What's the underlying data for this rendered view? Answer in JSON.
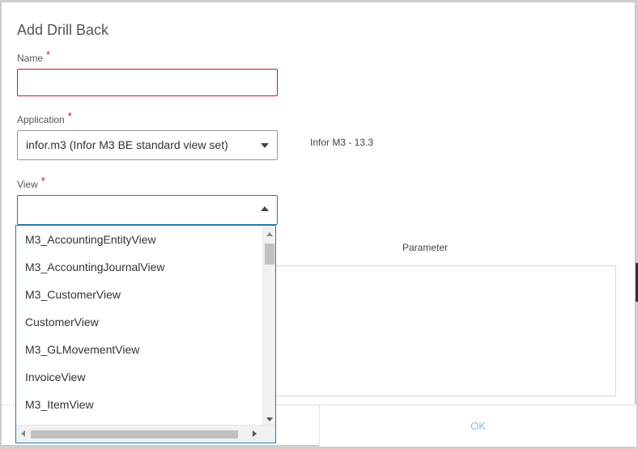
{
  "dialog": {
    "title": "Add Drill Back",
    "ok_label": "OK"
  },
  "fields": {
    "name": {
      "label": "Name",
      "required_mark": "*",
      "value": ""
    },
    "application": {
      "label": "Application",
      "required_mark": "*",
      "selected": "infor.m3 (Infor M3 BE standard view set)",
      "version_text": "Infor M3 - 13.3"
    },
    "view": {
      "label": "View",
      "required_mark": "*",
      "selected": "",
      "options": [
        "M3_AccountingEntityView",
        "M3_AccountingJournalView",
        "M3_CustomerView",
        "CustomerView",
        "M3_GLMovementView",
        "InvoiceView",
        "M3_ItemView"
      ]
    },
    "parameter": {
      "label": "Parameter"
    }
  },
  "icons": {
    "application_dropdown": "chevron-down-icon",
    "view_dropdown": "chevron-up-icon"
  },
  "colors": {
    "required": "#da1217",
    "focus_border": "#2578a9",
    "ok_text": "#8fb8d6"
  }
}
